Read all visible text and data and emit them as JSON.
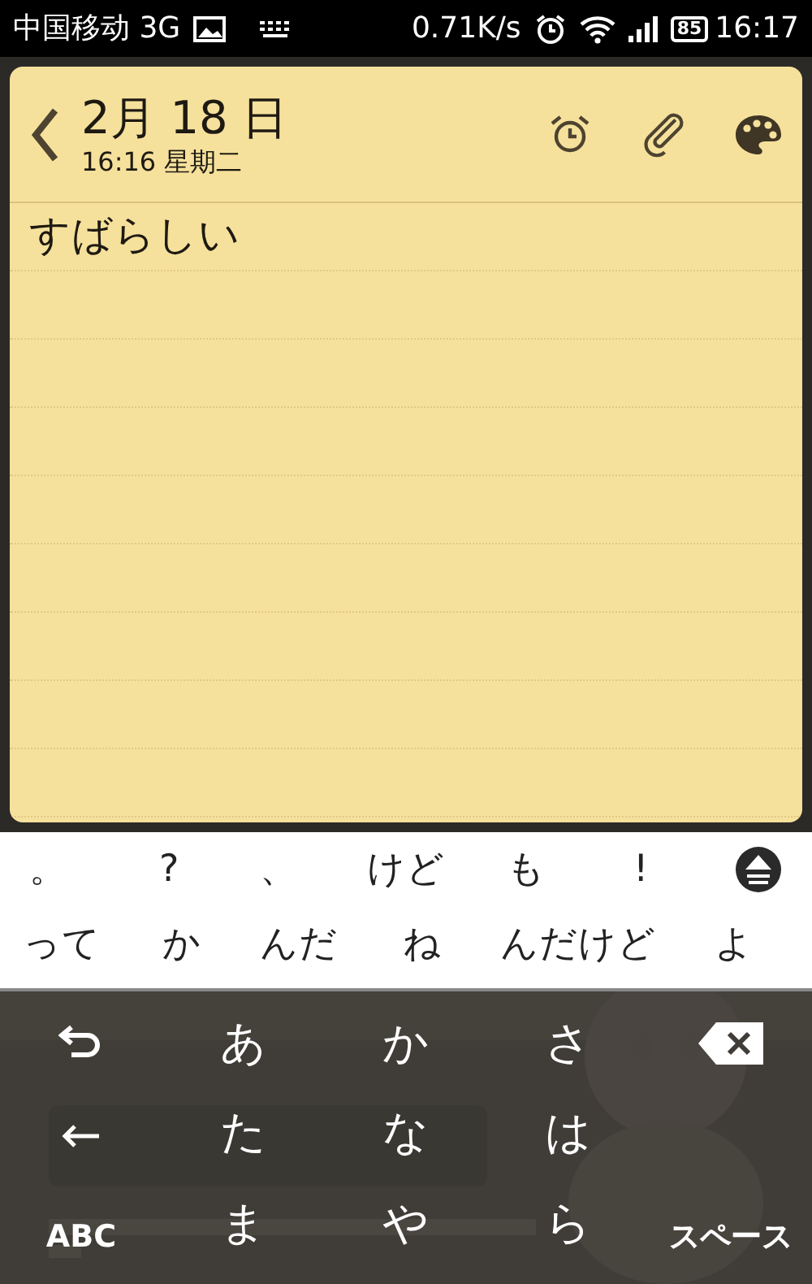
{
  "status_bar": {
    "carrier": "中国移动 3G",
    "speed": "0.71K/s",
    "battery": "85",
    "time": "16:17"
  },
  "note": {
    "title": "2月 18 日",
    "subtitle": "16:16 星期二",
    "lines": [
      "すばらしい"
    ]
  },
  "suggestions": [
    [
      "。",
      "?",
      "、",
      "けど",
      "も",
      "!"
    ],
    [
      "って",
      "か",
      "んだ",
      "ね",
      "んだけど",
      "よ"
    ]
  ],
  "keyboard": {
    "background": {
      "kind": "picture"
    },
    "rows": [
      [
        {
          "kind": "undo"
        },
        {
          "kind": "char",
          "label": "あ"
        },
        {
          "kind": "char",
          "label": "か"
        },
        {
          "kind": "char",
          "label": "さ"
        },
        {
          "kind": "delete"
        }
      ],
      [
        {
          "kind": "left"
        },
        {
          "kind": "char",
          "label": "た"
        },
        {
          "kind": "char",
          "label": "な"
        },
        {
          "kind": "char",
          "label": "は"
        },
        {
          "kind": "blank"
        }
      ],
      [
        {
          "kind": "small",
          "label": "ABC"
        },
        {
          "kind": "char",
          "label": "ま"
        },
        {
          "kind": "char",
          "label": "や"
        },
        {
          "kind": "char",
          "label": "ら"
        },
        {
          "kind": "small",
          "label": "スペース"
        }
      ]
    ]
  }
}
